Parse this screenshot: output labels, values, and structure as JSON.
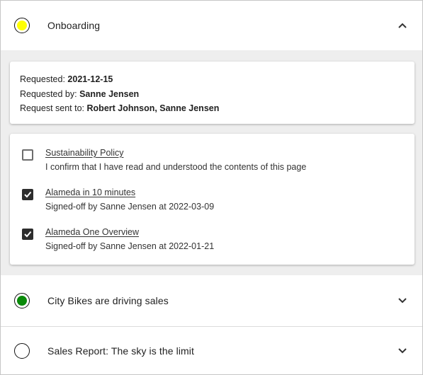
{
  "accordions": [
    {
      "title": "Onboarding",
      "status_color": "#ffff00",
      "expanded": true,
      "chevron_icon": "chevron-up-icon"
    },
    {
      "title": "City Bikes are driving sales",
      "status_color": "#0a8a0a",
      "expanded": false,
      "chevron_icon": "chevron-down-icon"
    },
    {
      "title": "Sales Report: The sky is the limit",
      "status_color": "#ffffff",
      "expanded": false,
      "chevron_icon": "chevron-down-icon"
    }
  ],
  "request_info": {
    "requested_label": "Requested:",
    "requested_value": "2021-12-15",
    "requested_by_label": "Requested by:",
    "requested_by_value": "Sanne Jensen",
    "sent_to_label": "Request sent to:",
    "sent_to_value": "Robert Johnson, Sanne Jensen"
  },
  "tasks": [
    {
      "checked": false,
      "title": "Sustainability Policy",
      "description": "I confirm that I have read and understood the contents of this page"
    },
    {
      "checked": true,
      "title": "Alameda in 10 minutes",
      "description": "Signed-off by Sanne Jensen at 2022-03-09"
    },
    {
      "checked": true,
      "title": "Alameda One Overview",
      "description": "Signed-off by Sanne Jensen at 2022-01-21"
    }
  ]
}
